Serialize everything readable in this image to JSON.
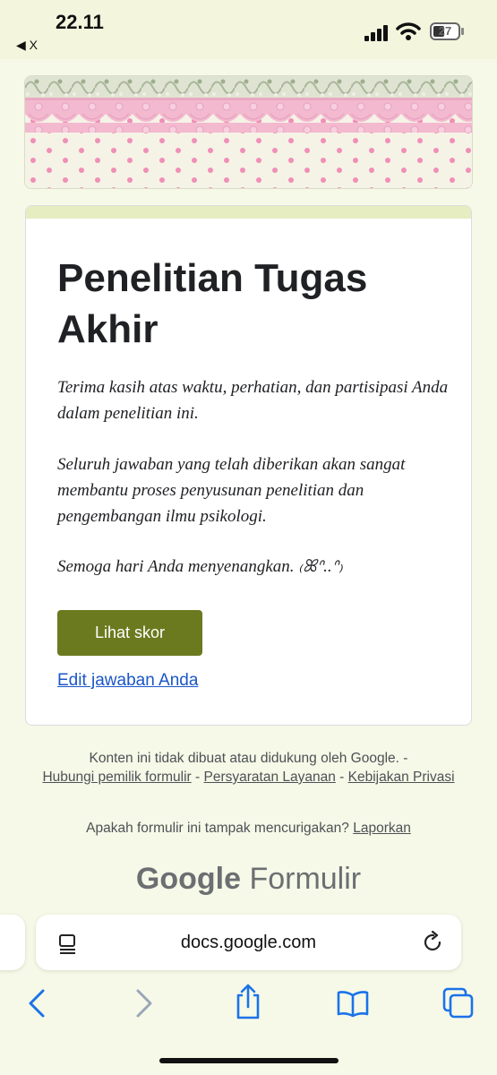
{
  "status_bar": {
    "time": "22.11",
    "back_app": "◀ X",
    "battery": "27"
  },
  "form": {
    "title": "Penelitian Tugas Akhir",
    "paragraphs": [
      "Terima kasih atas waktu, perhatian, dan partisipasi Anda dalam penelitian ini.",
      "Seluruh jawaban yang telah diberikan akan sangat membantu proses penyusunan penelitian dan pengembangan ilmu psikologi.",
      "Semoga hari Anda menyenangkan. ₍ꕤᐢ..ᐢ₎"
    ],
    "score_button": "Lihat skor",
    "edit_link": "Edit jawaban Anda"
  },
  "footer": {
    "disclaimer": "Konten ini tidak dibuat atau didukung oleh Google. -",
    "contact_owner": "Hubungi pemilik formulir",
    "sep": " - ",
    "terms": "Persyaratan Layanan",
    "privacy": "Kebijakan Privasi",
    "suspicious": "Apakah formulir ini tampak mencurigakan?",
    "report": "Laporkan",
    "brand_google": "Google",
    "brand_forms": "Formulir"
  },
  "browser": {
    "url": "docs.google.com"
  },
  "colors": {
    "accent": "#6b7a1f",
    "background": "#f6f9e7",
    "link": "#1a56c7"
  }
}
